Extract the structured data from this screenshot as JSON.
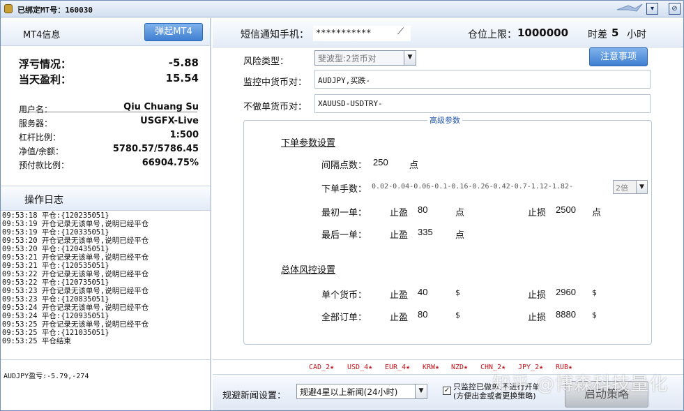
{
  "window": {
    "title": "已绑定MT号：160030"
  },
  "left": {
    "mt4_label": "MT4信息",
    "popup_mt4_button": "弹起MT4",
    "floating_label": "浮亏情况：",
    "floating_value": "-5.88",
    "today_label": "当天盈利：",
    "today_value": "15.54",
    "info": [
      {
        "label": "用户名：",
        "value": "Qiu Chuang Su"
      },
      {
        "label": "服务器：",
        "value": "USGFX-Live"
      },
      {
        "label": "杠杆比例：",
        "value": "1:500"
      },
      {
        "label": "净值/余额：",
        "value": "5780.57/5786.45"
      },
      {
        "label": "预付款比例：",
        "value": "66904.75%"
      }
    ],
    "log_title": "操作日志",
    "log": [
      "09:53:18 平仓:{120235051}",
      "09:53:19 开仓记录无该单号,说明已经平仓",
      "09:53:19 平仓:{120335051}",
      "09:53:20 开仓记录无该单号,说明已经平仓",
      "09:53:20 平仓:{120435051}",
      "09:53:21 开仓记录无该单号,说明已经平仓",
      "09:53:21 平仓:{120535051}",
      "09:53:22 开仓记录无该单号,说明已经平仓",
      "09:53:22 平仓:{120735051}",
      "09:53:23 开仓记录无该单号,说明已经平仓",
      "09:53:23 平仓:{120835051}",
      "09:53:24 开仓记录无该单号,说明已经平仓",
      "09:53:24 平仓:{120935051}",
      "09:53:25 开仓记录无该单号,说明已经平仓",
      "09:53:25 平仓:{121035051}",
      "09:53:25 平仓结束"
    ],
    "status_text": "AUDJPY盈亏:-5.79,-274"
  },
  "right": {
    "sms_label": "短信通知手机：",
    "sms_value": "***********",
    "pos_limit_label": "仓位上限：",
    "pos_limit_value": "1000000",
    "tz_label": "时差",
    "tz_value": "5",
    "tz_unit": "小时",
    "risk_label": "风险类型：",
    "risk_value": "斐波型:2货币对",
    "notice_button": "注意事项",
    "monitor_label": "监控中货币对：",
    "monitor_value": "AUDJPY,买跌-",
    "exclude_label": "不做单货币对：",
    "exclude_value": "XAUUSD-USDTRY-",
    "advanced_title": "高级参数",
    "order_section": "下单参数设置",
    "interval_label": "间隔点数：",
    "interval_value": "250",
    "point_unit": "点",
    "lots_label": "下单手数：",
    "lots_value": "0.02-0.04-0.06-0.1-0.16-0.26-0.42-0.7-1.12-1.82-",
    "multiplier": "2倍",
    "first_label": "最初一单：",
    "tp_label": "止盈",
    "sl_label": "止损",
    "first_tp": "80",
    "first_sl": "2500",
    "last_label": "最后一单：",
    "last_tp": "335",
    "risk_section": "总体风控设置",
    "single_label": "单个货币：",
    "single_tp": "40",
    "single_sl": "2960",
    "all_label": "全部订单：",
    "all_tp": "80",
    "all_sl": "8880",
    "dollar_unit": "$",
    "stars": [
      "CAD_2★",
      "USD_4★",
      "EUR_4★",
      "KRW★",
      "NZD★",
      "CHN_2★",
      "JPY_2★",
      "RUB★"
    ],
    "news_label": "规避新闻设置：",
    "news_value": "规避4星以上新闻(24小时)",
    "monitor_only_line1": "只监控已做单,不进行开单",
    "monitor_only_line2": "(方便出金或者更换策略)",
    "start_button": "启动策略",
    "watermark": "知乎 @博森科技量化"
  },
  "colors": {
    "accent": "#3f7fd1",
    "star_red": "#c4141a",
    "panel_bg": "#e3ecf7"
  }
}
